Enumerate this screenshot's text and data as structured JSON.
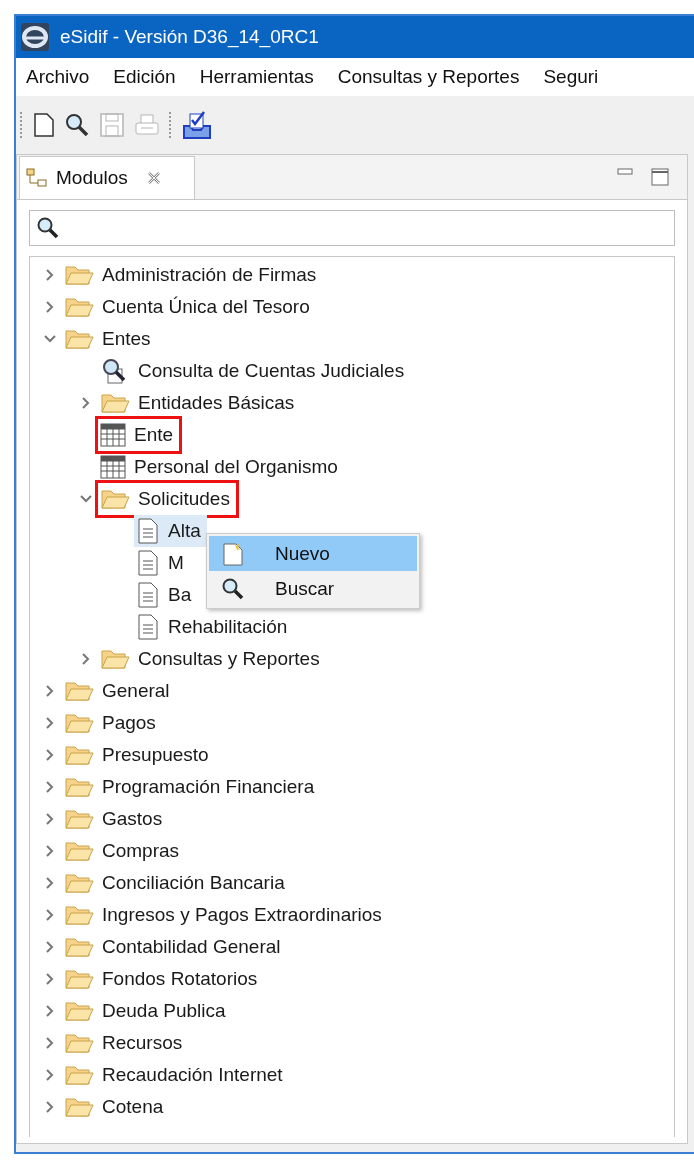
{
  "window": {
    "title": "eSidif - Versión D36_14_0RC1"
  },
  "menu": [
    "Archivo",
    "Edición",
    "Herramientas",
    "Consultas y Reportes",
    "Seguri"
  ],
  "toolbar": [
    {
      "kind": "new",
      "disabled": false
    },
    {
      "kind": "search",
      "disabled": false
    },
    {
      "kind": "save",
      "disabled": true
    },
    {
      "kind": "print",
      "disabled": true
    },
    {
      "kind": "separator"
    },
    {
      "kind": "tray"
    }
  ],
  "view": {
    "tab": {
      "label": "Modulos",
      "selected": true
    }
  },
  "tree": [
    {
      "label": "Administración de Firmas",
      "kind": "folder",
      "expanded": false,
      "selected": false,
      "marked": false
    },
    {
      "label": "Cuenta Única del Tesoro",
      "kind": "folder",
      "expanded": false,
      "selected": false,
      "marked": false
    },
    {
      "label": "Entes",
      "kind": "folder",
      "expanded": true,
      "selected": false,
      "marked": false,
      "children": [
        {
          "label": "Consulta de Cuentas Judiciales",
          "kind": "query",
          "selected": false,
          "marked": false
        },
        {
          "label": "Entidades Básicas",
          "kind": "folder",
          "expanded": false,
          "selected": false,
          "marked": false
        },
        {
          "label": "Ente",
          "kind": "table",
          "selected": false,
          "marked": true
        },
        {
          "label": "Personal del Organismo",
          "kind": "table",
          "selected": false,
          "marked": false
        },
        {
          "label": "Solicitudes",
          "kind": "folder",
          "expanded": true,
          "selected": false,
          "marked": true,
          "children": [
            {
              "label": "Alta",
              "kind": "document",
              "selected": true,
              "marked": false
            },
            {
              "label": "M",
              "kind": "document",
              "selected": false,
              "marked": false
            },
            {
              "label": "Ba",
              "kind": "document",
              "selected": false,
              "marked": false
            },
            {
              "label": "Rehabilitación",
              "kind": "document",
              "selected": false,
              "marked": false
            }
          ]
        },
        {
          "label": "Consultas y Reportes",
          "kind": "folder",
          "expanded": false,
          "selected": false,
          "marked": false
        }
      ]
    },
    {
      "label": "General",
      "kind": "folder",
      "expanded": false,
      "selected": false,
      "marked": false
    },
    {
      "label": "Pagos",
      "kind": "folder",
      "expanded": false,
      "selected": false,
      "marked": false
    },
    {
      "label": "Presupuesto",
      "kind": "folder",
      "expanded": false,
      "selected": false,
      "marked": false
    },
    {
      "label": "Programación Financiera",
      "kind": "folder",
      "expanded": false,
      "selected": false,
      "marked": false
    },
    {
      "label": "Gastos",
      "kind": "folder",
      "expanded": false,
      "selected": false,
      "marked": false
    },
    {
      "label": "Compras",
      "kind": "folder",
      "expanded": false,
      "selected": false,
      "marked": false
    },
    {
      "label": "Conciliación Bancaria",
      "kind": "folder",
      "expanded": false,
      "selected": false,
      "marked": false
    },
    {
      "label": "Ingresos y Pagos Extraordinarios",
      "kind": "folder",
      "expanded": false,
      "selected": false,
      "marked": false
    },
    {
      "label": "Contabilidad General",
      "kind": "folder",
      "expanded": false,
      "selected": false,
      "marked": false
    },
    {
      "label": "Fondos Rotatorios",
      "kind": "folder",
      "expanded": false,
      "selected": false,
      "marked": false
    },
    {
      "label": "Deuda Publica",
      "kind": "folder",
      "expanded": false,
      "selected": false,
      "marked": false
    },
    {
      "label": "Recursos",
      "kind": "folder",
      "expanded": false,
      "selected": false,
      "marked": false
    },
    {
      "label": "Recaudación Internet",
      "kind": "folder",
      "expanded": false,
      "selected": false,
      "marked": false
    },
    {
      "label": "Cotena",
      "kind": "folder",
      "expanded": false,
      "selected": false,
      "marked": false
    }
  ],
  "context_menu": [
    {
      "label": "Nuevo",
      "kind": "new",
      "selected": true
    },
    {
      "label": "Buscar",
      "kind": "search",
      "selected": false
    }
  ]
}
